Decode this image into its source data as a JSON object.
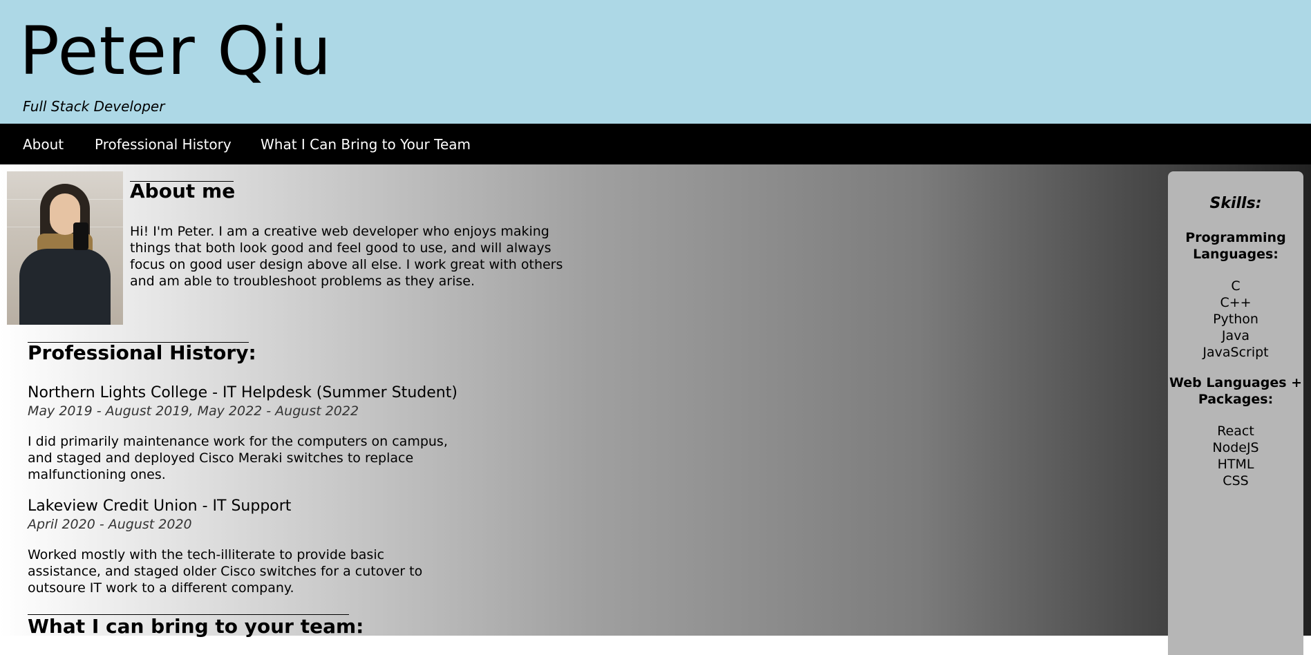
{
  "header": {
    "title": "Peter Qiu",
    "subtitle": "Full Stack Developer"
  },
  "nav": {
    "items": [
      "About",
      "Professional History",
      "What I Can Bring to Your Team"
    ]
  },
  "about": {
    "heading": "About me",
    "text": "Hi! I'm Peter. I am a creative web developer who enjoys making things that both look good and feel good to use, and will always focus on good user design above all else. I work great with others and am able to troubleshoot problems as they arise."
  },
  "history": {
    "heading": "Professional History:",
    "jobs": [
      {
        "title": "Northern Lights College - IT Helpdesk (Summer Student)",
        "dates": "May 2019 - August 2019, May 2022 - August 2022",
        "description": "I did primarily maintenance work for the computers on campus, and staged and deployed Cisco Meraki switches to replace malfunctioning ones."
      },
      {
        "title": "Lakeview Credit Union - IT Support",
        "dates": "April 2020 - August 2020",
        "description": "Worked mostly with the tech-illiterate to provide basic assistance, and staged older Cisco switches for a cutover to outsoure IT work to a different company."
      }
    ]
  },
  "bring": {
    "heading": "What I can bring to your team:"
  },
  "skills": {
    "title": "Skills:",
    "groups": [
      {
        "heading": "Programming Languages:",
        "items": [
          "C",
          "C++",
          "Python",
          "Java",
          "JavaScript"
        ]
      },
      {
        "heading": "Web Languages + Packages:",
        "items": [
          "React",
          "NodeJS",
          "HTML",
          "CSS"
        ]
      }
    ]
  },
  "colors": {
    "header_bg": "#add8e6",
    "nav_bg": "#000000",
    "nav_text": "#ffffff",
    "skills_bg": "#b6b6b6"
  }
}
